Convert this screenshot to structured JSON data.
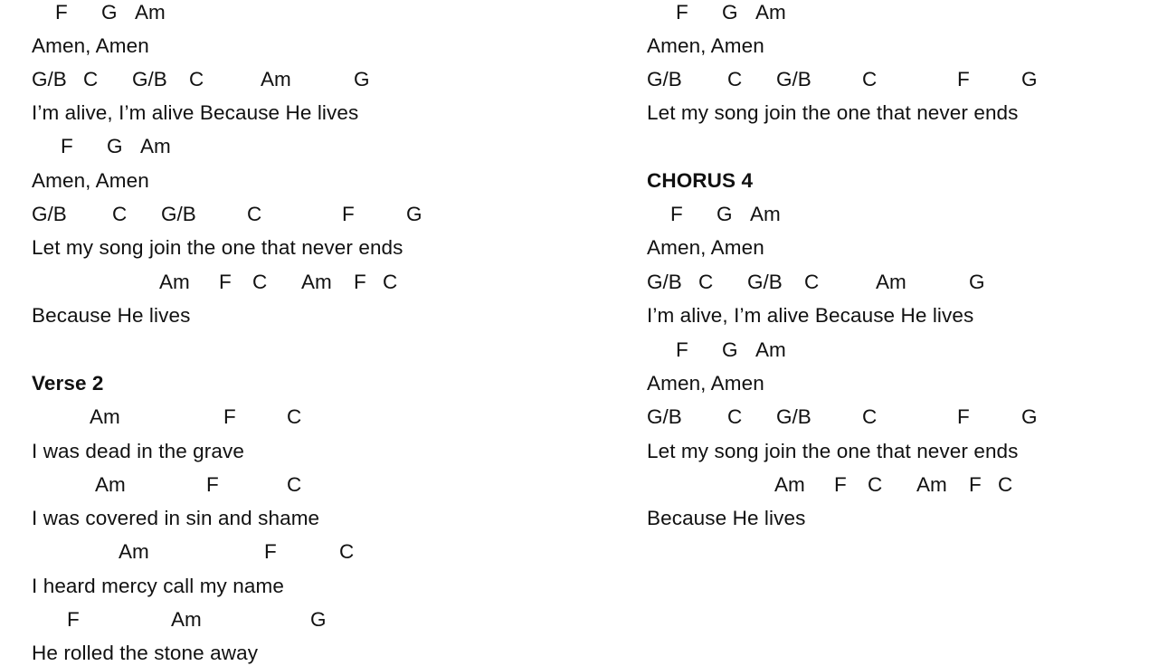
{
  "document": {
    "left": {
      "chords": [
        [
          "F",
          "G",
          "Am"
        ],
        [
          "G/B",
          "C",
          "G/B",
          "C",
          "Am",
          "G"
        ],
        [
          "F",
          "G",
          "Am"
        ],
        [
          "G/B",
          "C",
          "G/B",
          "C",
          "F",
          "G"
        ],
        [
          "Am",
          "F",
          "C",
          "Am",
          "F",
          "C"
        ],
        [
          "Am",
          "F",
          "C"
        ],
        [
          "Am",
          "F",
          "C"
        ],
        [
          "Am",
          "F",
          "C"
        ],
        [
          "F",
          "Am",
          "G"
        ]
      ],
      "lyrics": [
        "Amen, Amen",
        "I’m alive, I’m alive Because He lives",
        "Amen, Amen",
        "Let my song join the one that never ends",
        "Because He lives",
        "I was dead in the grave",
        "I was covered in sin and shame",
        "I heard mercy call my name",
        "He rolled the stone away"
      ],
      "heading": "Verse 2"
    },
    "right": {
      "chords": [
        [
          "F",
          "G",
          "Am"
        ],
        [
          "G/B",
          "C",
          "G/B",
          "C",
          "F",
          "G"
        ],
        [
          "F",
          "G",
          "Am"
        ],
        [
          "G/B",
          "C",
          "G/B",
          "C",
          "Am",
          "G"
        ],
        [
          "F",
          "G",
          "Am"
        ],
        [
          "G/B",
          "C",
          "G/B",
          "C",
          "F",
          "G"
        ],
        [
          "Am",
          "F",
          "C",
          "Am",
          "F",
          "C"
        ]
      ],
      "lyrics": [
        "Amen, Amen",
        "Let my song join the one that never ends",
        "Amen, Amen",
        "I’m alive, I’m alive Because He lives",
        "Amen, Amen",
        "Let my song join the one that never ends",
        "Because He lives"
      ],
      "heading": "CHORUS 4"
    }
  }
}
